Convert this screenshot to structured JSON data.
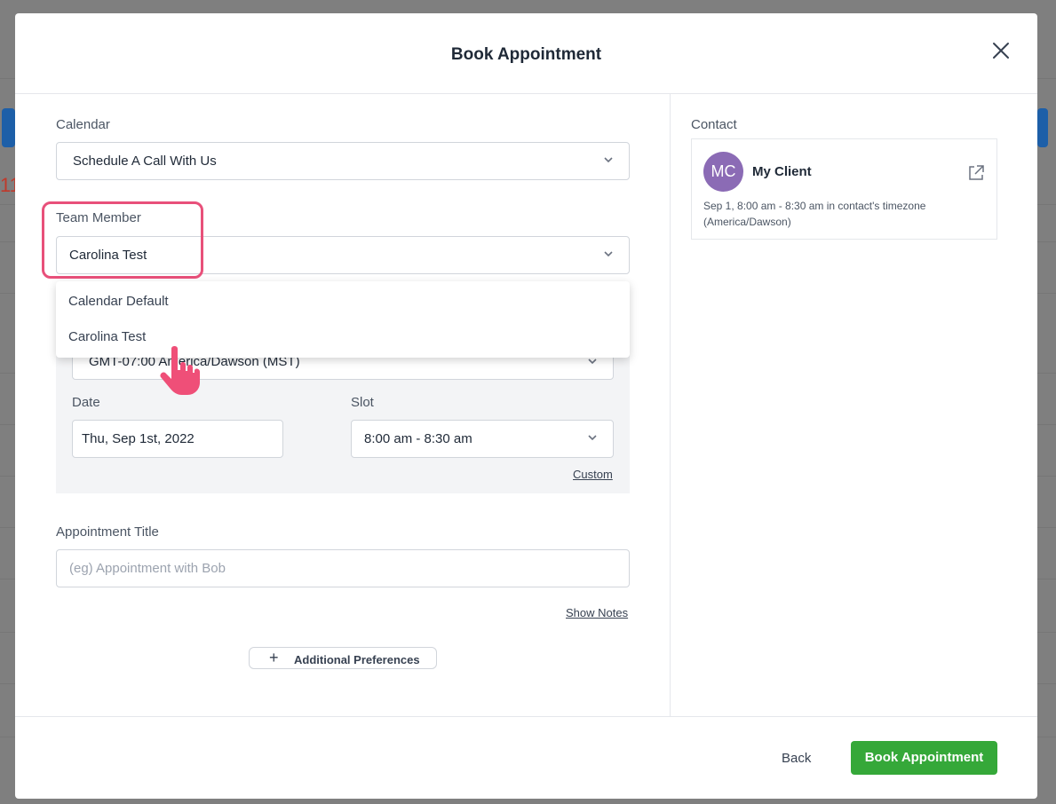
{
  "background": {
    "partial_text": "11"
  },
  "modal": {
    "title": "Book Appointment",
    "close_icon": "close-icon"
  },
  "form": {
    "calendar": {
      "label": "Calendar",
      "value": "Schedule A Call With Us"
    },
    "team_member": {
      "label": "Team Member",
      "value": "Carolina Test",
      "options": [
        "Calendar Default",
        "Carolina Test"
      ]
    },
    "timezone": {
      "value": "GMT-07:00 America/Dawson (MST)"
    },
    "date": {
      "label": "Date",
      "value": "Thu, Sep 1st, 2022"
    },
    "slot": {
      "label": "Slot",
      "value": "8:00 am - 8:30 am"
    },
    "custom_link": "Custom",
    "appointment_title": {
      "label": "Appointment Title",
      "placeholder": "(eg) Appointment with Bob"
    },
    "show_notes_link": "Show Notes",
    "additional_preferences": "Additional Preferences"
  },
  "contact": {
    "label": "Contact",
    "initials": "MC",
    "name": "My Client",
    "info": "Sep 1, 8:00 am - 8:30 am in contact's timezone (America/Dawson)",
    "avatar_color": "#8b6bb5"
  },
  "footer": {
    "back_label": "Back",
    "book_label": "Book Appointment",
    "book_color": "#35a839"
  },
  "highlight_color": "#e8507a"
}
